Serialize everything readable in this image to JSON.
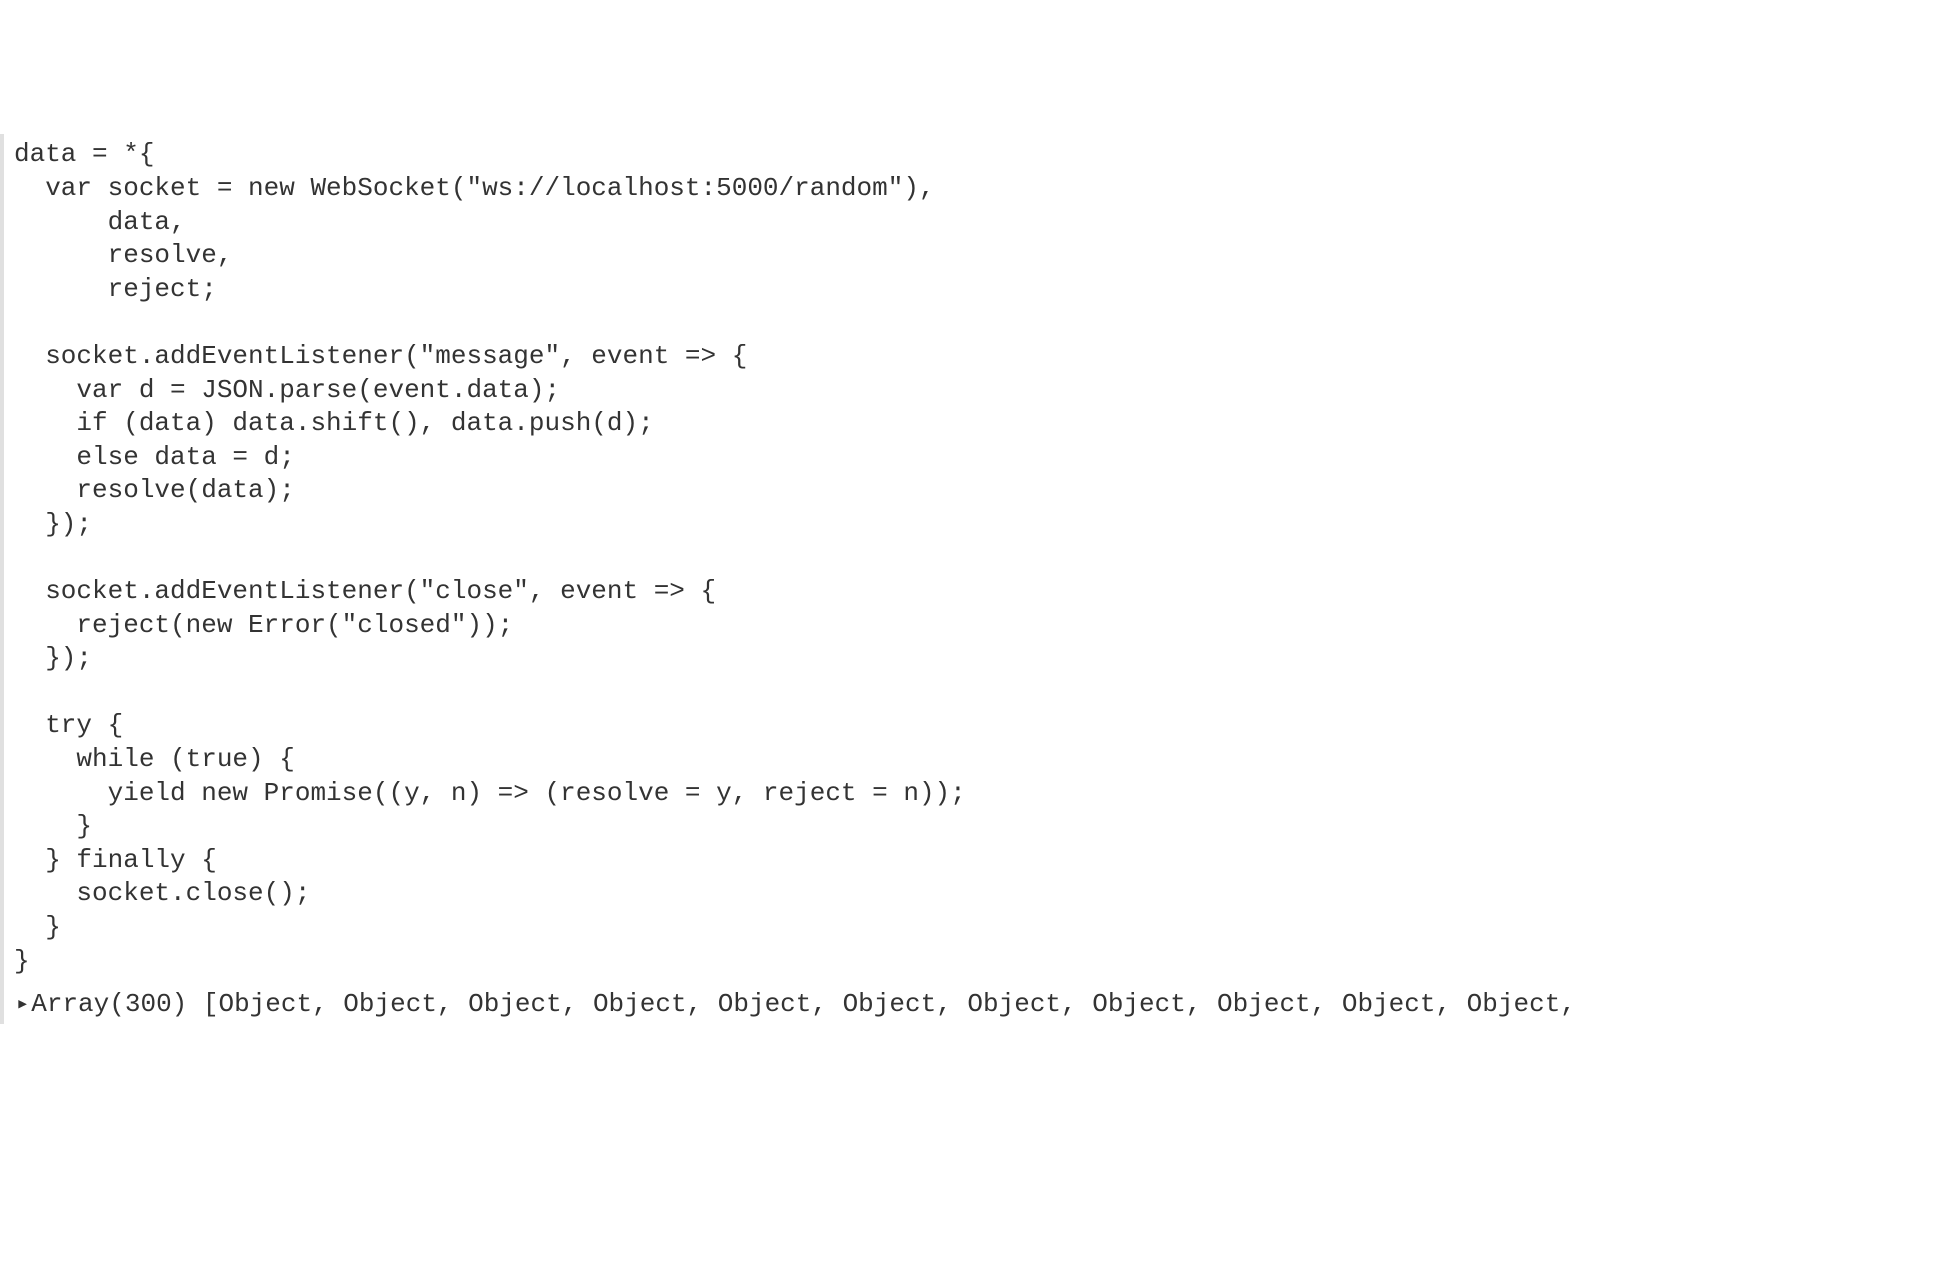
{
  "code": {
    "l01": "data = *{",
    "l02": "  var socket = new WebSocket(\"ws://localhost:5000/random\"),",
    "l03": "      data,",
    "l04": "      resolve,",
    "l05": "      reject;",
    "l06": "",
    "l07": "  socket.addEventListener(\"message\", event => {",
    "l08": "    var d = JSON.parse(event.data);",
    "l09": "    if (data) data.shift(), data.push(d);",
    "l10": "    else data = d;",
    "l11": "    resolve(data);",
    "l12": "  });",
    "l13": "",
    "l14": "  socket.addEventListener(\"close\", event => {",
    "l15": "    reject(new Error(\"closed\"));",
    "l16": "  });",
    "l17": "",
    "l18": "  try {",
    "l19": "    while (true) {",
    "l20": "      yield new Promise((y, n) => (resolve = y, reject = n));",
    "l21": "    }",
    "l22": "  } finally {",
    "l23": "    socket.close();",
    "l24": "  }",
    "l25": "}"
  },
  "output": {
    "caret": "▸",
    "text": "Array(300) [Object, Object, Object, Object, Object, Object, Object, Object, Object, Object, Object,"
  }
}
